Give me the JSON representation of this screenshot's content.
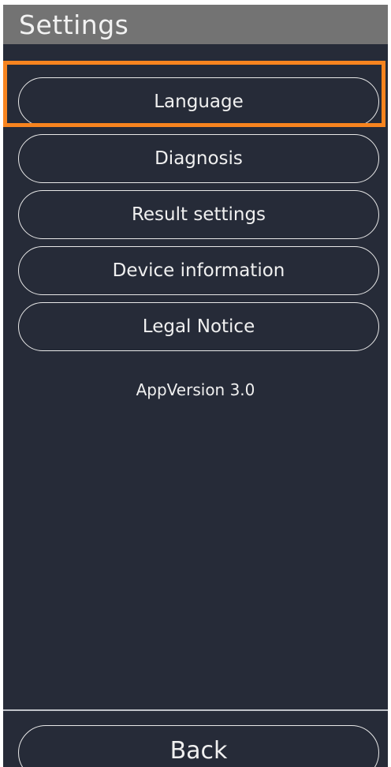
{
  "header": {
    "title": "Settings"
  },
  "menu": {
    "items": [
      {
        "label": "Language"
      },
      {
        "label": "Diagnosis"
      },
      {
        "label": "Result settings"
      },
      {
        "label": "Device information"
      },
      {
        "label": "Legal Notice"
      }
    ]
  },
  "footer": {
    "app_version": "AppVersion 3.0",
    "back_label": "Back"
  },
  "colors": {
    "background": "#262b38",
    "header": "#737373",
    "highlight": "#f7841f",
    "text": "#f0f0f0"
  }
}
